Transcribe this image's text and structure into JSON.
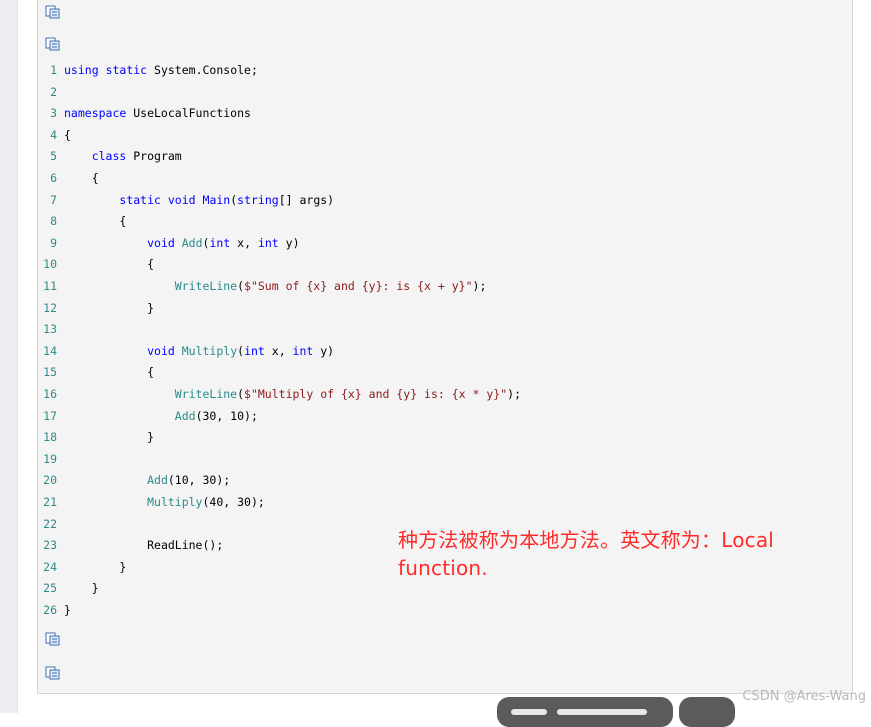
{
  "code": {
    "lines": [
      {
        "num": "1",
        "text": "using static System.Console;"
      },
      {
        "num": "2",
        "text": ""
      },
      {
        "num": "3",
        "text": "namespace UseLocalFunctions"
      },
      {
        "num": "4",
        "text": "{"
      },
      {
        "num": "5",
        "text": "    class Program"
      },
      {
        "num": "6",
        "text": "    {"
      },
      {
        "num": "7",
        "text": "        static void Main(string[] args)"
      },
      {
        "num": "8",
        "text": "        {"
      },
      {
        "num": "9",
        "text": "            void Add(int x, int y)"
      },
      {
        "num": "10",
        "text": "            {"
      },
      {
        "num": "11",
        "text": "                WriteLine($\"Sum of {x} and {y}: is {x + y}\");"
      },
      {
        "num": "12",
        "text": "            }"
      },
      {
        "num": "13",
        "text": ""
      },
      {
        "num": "14",
        "text": "            void Multiply(int x, int y)"
      },
      {
        "num": "15",
        "text": "            {"
      },
      {
        "num": "16",
        "text": "                WriteLine($\"Multiply of {x} and {y} is: {x * y}\");"
      },
      {
        "num": "17",
        "text": "                Add(30, 10);"
      },
      {
        "num": "18",
        "text": "            }"
      },
      {
        "num": "19",
        "text": ""
      },
      {
        "num": "20",
        "text": "            Add(10, 30);"
      },
      {
        "num": "21",
        "text": "            Multiply(40, 30);"
      },
      {
        "num": "22",
        "text": ""
      },
      {
        "num": "23",
        "text": "            ReadLine();"
      },
      {
        "num": "24",
        "text": "        }"
      },
      {
        "num": "25",
        "text": "    }"
      },
      {
        "num": "26",
        "text": "}"
      }
    ]
  },
  "annotation": {
    "text": "种方法被称为本地方法。英文称为：Local function."
  },
  "watermark": {
    "text": "CSDN @Ares-Wang"
  },
  "icons": {
    "copy": "copy-to-clipboard-icon"
  },
  "colors": {
    "keyword": "#0000ff",
    "method": "#2b8a8a",
    "string": "#8b1a1a",
    "line_number": "#2f8a8a",
    "annotation": "#ff2a2a"
  }
}
